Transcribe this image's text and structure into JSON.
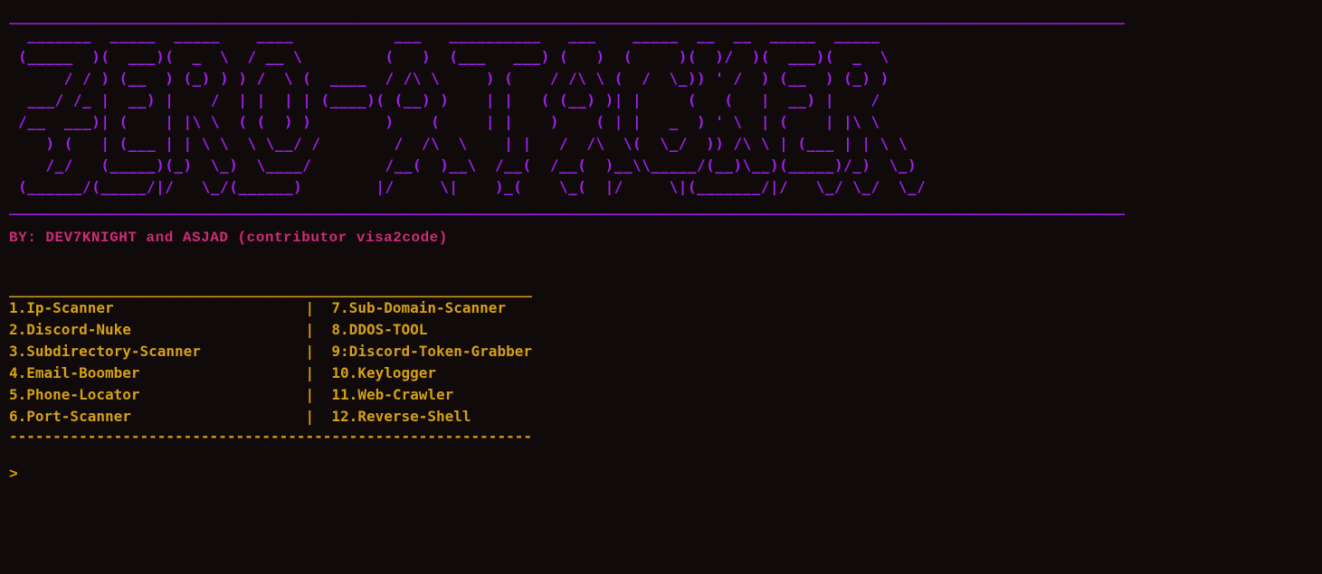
{
  "divider": {
    "top": "________________________________________________________________________________________________________________________________",
    "mid": "________________________________________________________________________________________________________________________________"
  },
  "ascii_art": {
    "lines": [
      "  _______  _____  _____    ____           ___   __________   ___    _____  __  __  _____  _____  ",
      " (_____  )(  ___)(  _  \\  / __ \\         (   )  (___   ___) (   )  (     )(  )/  )(  ___)(  _  \\ ",
      "      / / ) (__  ) (_) ) ) /  \\ (  ____  / /\\ \\     ) (    / /\\ \\ (  /  \\_)) ' /  ) (__  ) (_) ) ",
      "  ___/ /_ |  __) |    /  | |  | | (____)( (__) )    | |   ( (__) )| |     (   (   |  __) |    /  ",
      " /__  ___)| (    | |\\ \\  ( (  ) )        )    (     | |    )    ( | |   _  ) ' \\  | (    | |\\ \\  ",
      "    ) (   | (___ | | \\ \\  \\ \\__/ /        /  /\\  \\    | |   /  /\\  \\(  \\_/  )) /\\ \\ | (___ | | \\ \\ ",
      "    /_/   (_____)(_)  \\_)  \\____/        /__(  )__\\  /__(  /__(  )__\\\\_____/(__)\\__)(_____)/_)  \\_)",
      " (______/(_____/|/   \\_/(______)        |/     \\|    )_(    \\_(  |/     \\|(_______/|/   \\_/ \\_/  \\_/"
    ]
  },
  "byline": "BY: DEV7KNIGHT and ASJAD (contributor visa2code)",
  "menu": {
    "divider": "____________________________________________________________",
    "bottom_divider": "------------------------------------------------------------",
    "col1": [
      "1.Ip-Scanner",
      "2.Discord-Nuke",
      "3.Subdirectory-Scanner",
      "4.Email-Boomber",
      "5.Phone-Locator",
      "6.Port-Scanner"
    ],
    "col2": [
      "7.Sub-Domain-Scanner",
      "8.DDOS-TOOL",
      "9:Discord-Token-Grabber",
      "10.Keylogger",
      "11.Web-Crawler",
      "12.Reverse-Shell"
    ]
  },
  "prompt": ">"
}
